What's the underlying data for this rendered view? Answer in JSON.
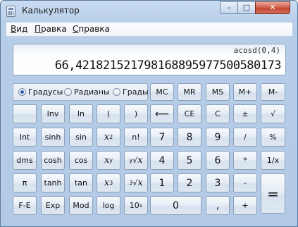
{
  "window": {
    "title": "Калькулятор",
    "controls": {
      "minimize": "–",
      "maximize": "□",
      "close": "✕"
    }
  },
  "menu": [
    {
      "mn": "В",
      "rest": "ид"
    },
    {
      "mn": "П",
      "rest": "равка"
    },
    {
      "mn": "С",
      "rest": "правка"
    }
  ],
  "display": {
    "expression": "acosd(0,4)",
    "value": "66,421821521798168895977500580173"
  },
  "angle_mode": {
    "options": [
      "Градусы",
      "Радианы",
      "Грады"
    ],
    "selected": "Градусы"
  },
  "memory": [
    "MC",
    "MR",
    "MS",
    "M+",
    "M-"
  ],
  "keys": {
    "inv": "Inv",
    "ln": "ln",
    "lparen": "(",
    "rparen": ")",
    "backspace": "⟵",
    "ce": "CE",
    "c": "C",
    "plusminus": "±",
    "sqrt": "√",
    "int": "Int",
    "sinh": "sinh",
    "sin": "sin",
    "square_base": "x",
    "square_exp": "2",
    "factorial": "n!",
    "d7": "7",
    "d8": "8",
    "d9": "9",
    "divide": "/",
    "percent": "%",
    "dms": "dms",
    "cosh": "cosh",
    "cos": "cos",
    "pow_base": "x",
    "pow_exp": "y",
    "yroot_idx": "y",
    "yroot_sym": "√",
    "yroot_x": "x",
    "d4": "4",
    "d5": "5",
    "d6": "6",
    "multiply": "*",
    "reciprocal": "1/x",
    "pi": "π",
    "tanh": "tanh",
    "tan": "tan",
    "cube_base": "x",
    "cube_exp": "3",
    "croot_idx": "3",
    "croot_sym": "√",
    "croot_x": "x",
    "d1": "1",
    "d2": "2",
    "d3": "3",
    "minus": "-",
    "equals": "=",
    "fe": "F-E",
    "exp": "Exp",
    "mod": "Mod",
    "log": "log",
    "tenx_base": "10",
    "tenx_exp": "x",
    "d0": "0",
    "decimal": ",",
    "plus": "+"
  }
}
